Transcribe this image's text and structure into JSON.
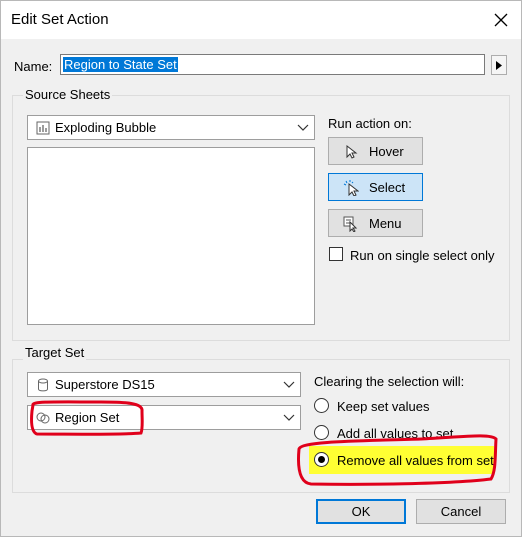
{
  "window": {
    "title": "Edit Set Action",
    "close_icon": "close-icon"
  },
  "name_field": {
    "label": "Name:",
    "value": "Region to State Set"
  },
  "source_sheets": {
    "group_label": "Source Sheets",
    "selected_sheet": "Exploding Bubble",
    "sheet_icon": "bar-chart-icon"
  },
  "run_action": {
    "label": "Run action on:",
    "buttons": [
      {
        "label": "Hover",
        "icon": "pointer-icon",
        "active": false
      },
      {
        "label": "Select",
        "icon": "click-pointer-icon",
        "active": true
      },
      {
        "label": "Menu",
        "icon": "menu-pointer-icon",
        "active": false
      }
    ],
    "single_select_label": "Run on single select only",
    "single_select_checked": false
  },
  "target_set": {
    "group_label": "Target Set",
    "datasource": "Superstore DS15",
    "datasource_icon": "database-icon",
    "set": "Region Set",
    "set_icon": "set-icon"
  },
  "clearing": {
    "label": "Clearing the selection will:",
    "options": [
      {
        "label": "Keep set values",
        "selected": false
      },
      {
        "label": "Add all values to set",
        "selected": false
      },
      {
        "label": "Remove all values from set",
        "selected": true
      }
    ],
    "highlight_color": "#ffff33"
  },
  "footer": {
    "ok_label": "OK",
    "cancel_label": "Cancel"
  },
  "annotation_color": "#e0001b"
}
